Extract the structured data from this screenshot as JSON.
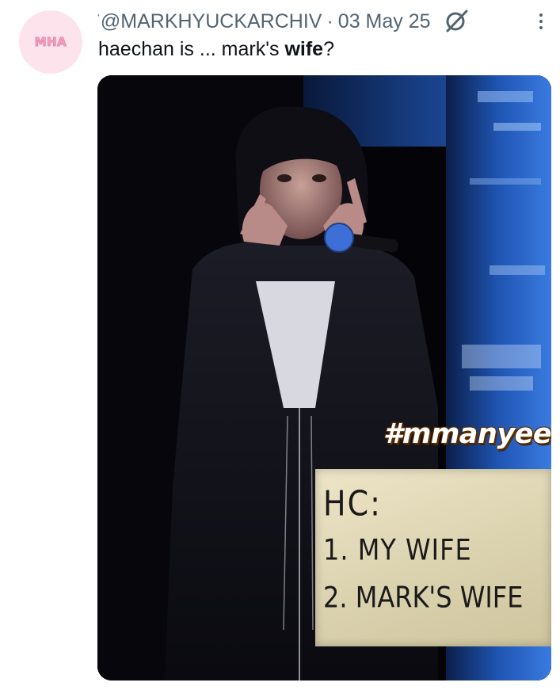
{
  "avatar": {
    "text": "MHA"
  },
  "post": {
    "handle_prefix": "ʻ",
    "handle": "@MARKHYUCKARCHIV",
    "separator": "·",
    "date": "03 May 25",
    "status_icon": "slashed-circle-icon",
    "more_icon": "more-options-icon",
    "text_before": "haechan is ... mark's ",
    "text_bold": "wife",
    "text_after": "?"
  },
  "media": {
    "hashtag": "#mmanyee",
    "sign_lines": [
      "HC:",
      "1. MY WIFE",
      "2. MARK'S WIFE"
    ]
  },
  "colors": {
    "secondary_text": "#536471",
    "primary_text": "#0f1419",
    "avatar_bg": "#fde3ec",
    "avatar_text": "#f5a3c0"
  }
}
